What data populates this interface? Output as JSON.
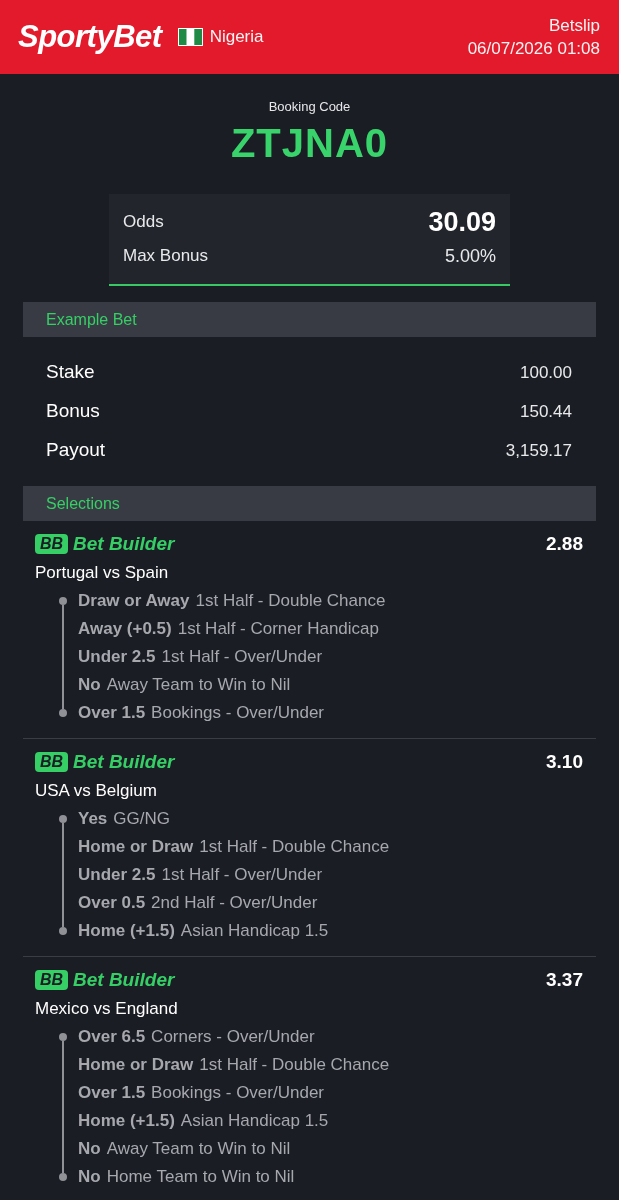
{
  "header": {
    "logo": "SportyBet",
    "country": "Nigeria",
    "title": "Betslip",
    "datetime": "06/07/2026 01:08"
  },
  "booking": {
    "label": "Booking Code",
    "code": "ZTJNA0"
  },
  "summary": [
    {
      "kind": "odds",
      "label": "Odds",
      "value": "30.09"
    },
    {
      "kind": "bonus",
      "label": "Max Bonus",
      "value": "5.00%"
    }
  ],
  "example_bet": {
    "title": "Example Bet",
    "rows": [
      {
        "label": "Stake",
        "value": "100.00"
      },
      {
        "label": "Bonus",
        "value": "150.44"
      },
      {
        "label": "Payout",
        "value": "3,159.17"
      }
    ]
  },
  "selections": {
    "title": "Selections",
    "bets": [
      {
        "badge": "BB",
        "type": "Bet Builder",
        "odds": "2.88",
        "match": "Portugal vs Spain",
        "legs": [
          {
            "pick": "Draw or Away",
            "market": "1st Half - Double Chance"
          },
          {
            "pick": "Away (+0.5)",
            "market": "1st Half - Corner Handicap"
          },
          {
            "pick": "Under 2.5",
            "market": "1st Half - Over/Under"
          },
          {
            "pick": "No",
            "market": "Away Team to Win to Nil"
          },
          {
            "pick": "Over 1.5",
            "market": "Bookings - Over/Under"
          }
        ]
      },
      {
        "badge": "BB",
        "type": "Bet Builder",
        "odds": "3.10",
        "match": "USA vs Belgium",
        "legs": [
          {
            "pick": "Yes",
            "market": "GG/NG"
          },
          {
            "pick": "Home or Draw",
            "market": "1st Half - Double Chance"
          },
          {
            "pick": "Under 2.5",
            "market": "1st Half - Over/Under"
          },
          {
            "pick": "Over 0.5",
            "market": "2nd Half - Over/Under"
          },
          {
            "pick": "Home (+1.5)",
            "market": "Asian Handicap 1.5"
          }
        ]
      },
      {
        "badge": "BB",
        "type": "Bet Builder",
        "odds": "3.37",
        "match": "Mexico vs England",
        "legs": [
          {
            "pick": "Over 6.5",
            "market": "Corners - Over/Under"
          },
          {
            "pick": "Home or Draw",
            "market": "1st Half - Double Chance"
          },
          {
            "pick": "Over 1.5",
            "market": "Bookings - Over/Under"
          },
          {
            "pick": "Home (+1.5)",
            "market": "Asian Handicap 1.5"
          },
          {
            "pick": "No",
            "market": "Away Team to Win to Nil"
          },
          {
            "pick": "No",
            "market": "Home Team to Win to Nil"
          }
        ]
      }
    ]
  }
}
